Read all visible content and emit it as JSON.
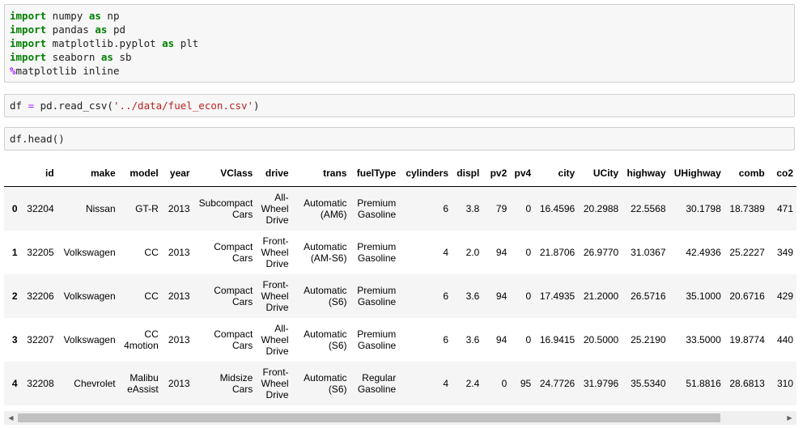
{
  "cells": [
    {
      "lines": [
        [
          {
            "t": "import",
            "c": "kw"
          },
          {
            "t": " numpy "
          },
          {
            "t": "as",
            "c": "kw"
          },
          {
            "t": " np"
          }
        ],
        [
          {
            "t": "import",
            "c": "kw"
          },
          {
            "t": " pandas "
          },
          {
            "t": "as",
            "c": "kw"
          },
          {
            "t": " pd"
          }
        ],
        [
          {
            "t": "import",
            "c": "kw"
          },
          {
            "t": " matplotlib.pyplot "
          },
          {
            "t": "as",
            "c": "kw"
          },
          {
            "t": " plt"
          }
        ],
        [
          {
            "t": "import",
            "c": "kw"
          },
          {
            "t": " seaborn "
          },
          {
            "t": "as",
            "c": "kw"
          },
          {
            "t": " sb"
          }
        ],
        [
          {
            "t": "%",
            "c": "mg"
          },
          {
            "t": "matplotlib inline"
          }
        ]
      ]
    },
    {
      "lines": [
        [
          {
            "t": "df "
          },
          {
            "t": "=",
            "c": "op"
          },
          {
            "t": " pd.read_csv("
          },
          {
            "t": "'../data/fuel_econ.csv'",
            "c": "str"
          },
          {
            "t": ")"
          }
        ]
      ]
    },
    {
      "lines": [
        [
          {
            "t": "df.head()"
          }
        ]
      ]
    }
  ],
  "dataframe": {
    "columns": [
      "",
      "id",
      "make",
      "model",
      "year",
      "VClass",
      "drive",
      "trans",
      "fuelType",
      "cylinders",
      "displ",
      "pv2",
      "pv4",
      "city",
      "UCity",
      "highway",
      "UHighway",
      "comb",
      "co2"
    ],
    "rows": [
      [
        "0",
        "32204",
        "Nissan",
        "GT-R",
        "2013",
        "Subcompact\nCars",
        "All-\nWheel\nDrive",
        "Automatic\n(AM6)",
        "Premium\nGasoline",
        "6",
        "3.8",
        "79",
        "0",
        "16.4596",
        "20.2988",
        "22.5568",
        "30.1798",
        "18.7389",
        "471"
      ],
      [
        "1",
        "32205",
        "Volkswagen",
        "CC",
        "2013",
        "Compact\nCars",
        "Front-\nWheel\nDrive",
        "Automatic\n(AM-S6)",
        "Premium\nGasoline",
        "4",
        "2.0",
        "94",
        "0",
        "21.8706",
        "26.9770",
        "31.0367",
        "42.4936",
        "25.2227",
        "349"
      ],
      [
        "2",
        "32206",
        "Volkswagen",
        "CC",
        "2013",
        "Compact\nCars",
        "Front-\nWheel\nDrive",
        "Automatic\n(S6)",
        "Premium\nGasoline",
        "6",
        "3.6",
        "94",
        "0",
        "17.4935",
        "21.2000",
        "26.5716",
        "35.1000",
        "20.6716",
        "429"
      ],
      [
        "3",
        "32207",
        "Volkswagen",
        "CC\n4motion",
        "2013",
        "Compact\nCars",
        "All-\nWheel\nDrive",
        "Automatic\n(S6)",
        "Premium\nGasoline",
        "6",
        "3.6",
        "94",
        "0",
        "16.9415",
        "20.5000",
        "25.2190",
        "33.5000",
        "19.8774",
        "440"
      ],
      [
        "4",
        "32208",
        "Chevrolet",
        "Malibu\neAssist",
        "2013",
        "Midsize\nCars",
        "Front-\nWheel\nDrive",
        "Automatic\n(S6)",
        "Regular\nGasoline",
        "4",
        "2.4",
        "0",
        "95",
        "24.7726",
        "31.9796",
        "35.5340",
        "51.8816",
        "28.6813",
        "310"
      ]
    ]
  },
  "scrollbar": {
    "left_arrow": "◀",
    "right_arrow": "▶"
  }
}
